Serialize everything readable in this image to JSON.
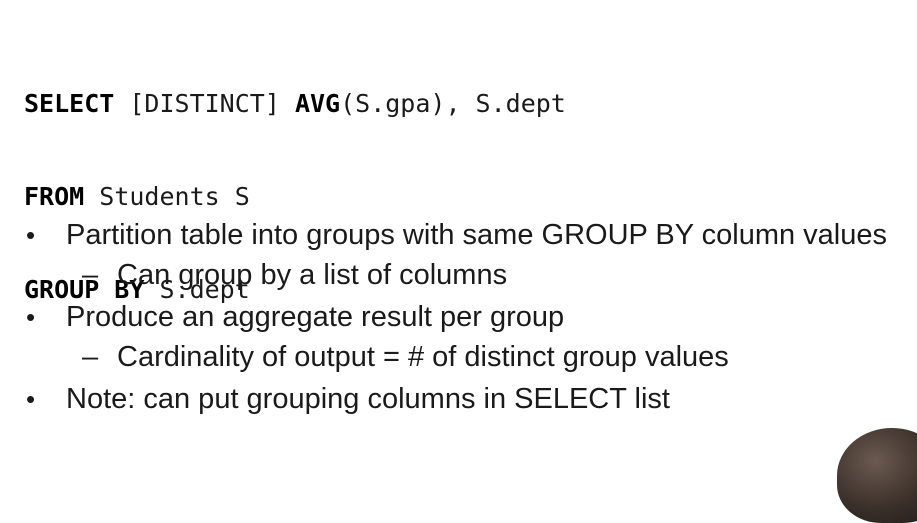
{
  "code": {
    "line1": {
      "kw1": "SELECT",
      "tx1": " [DISTINCT] ",
      "kw2": "AVG",
      "tx2": "(S.gpa), S.dept"
    },
    "line2": {
      "kw1": "FROM",
      "tx1": " Students S"
    },
    "line3": {
      "kw1": "GROUP BY",
      "tx1": " S.dept"
    }
  },
  "bullets": [
    {
      "text": "Partition table into groups with same GROUP BY column values",
      "sub": "Can group by a list of columns"
    },
    {
      "text": "Produce an aggregate result per group",
      "sub": "Cardinality of output = # of distinct group values"
    },
    {
      "text": "Note: can put grouping columns in SELECT list"
    }
  ],
  "glyphs": {
    "bullet": "•",
    "dash": "–"
  }
}
